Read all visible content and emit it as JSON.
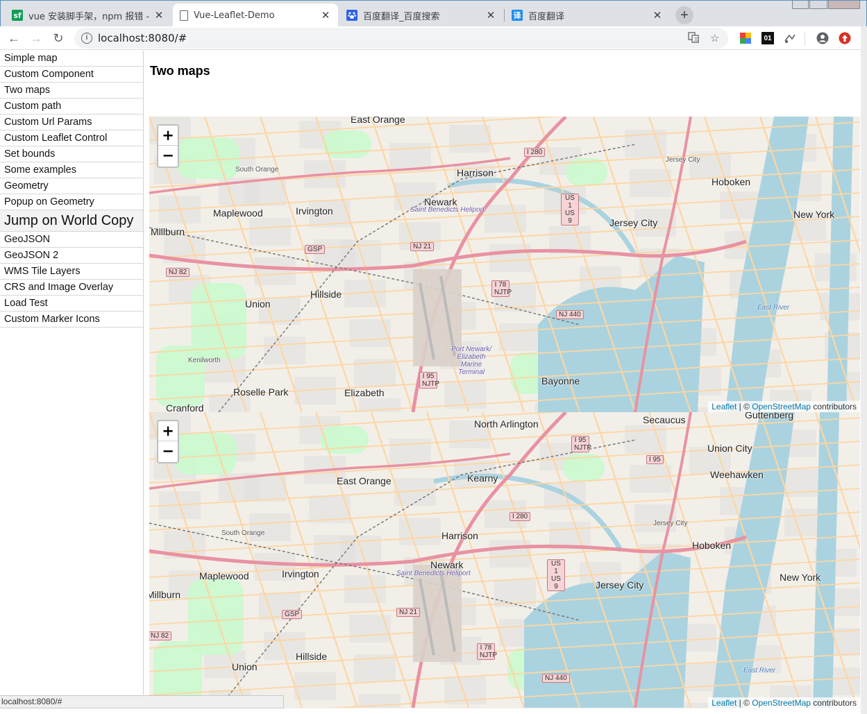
{
  "browser": {
    "tabs": [
      {
        "title": "vue 安装脚手架，npm 报错 - 青",
        "favicon": "sf",
        "favicon_color": "#0f9d58",
        "active": false
      },
      {
        "title": "Vue-Leaflet-Demo",
        "favicon": "doc",
        "favicon_color": "#5f6368",
        "active": true
      },
      {
        "title": "百度翻译_百度搜索",
        "favicon": "paw",
        "favicon_color": "#2f62e8",
        "active": false
      },
      {
        "title": "百度翻译",
        "favicon": "译",
        "favicon_color": "#1f8ef1",
        "active": false
      }
    ],
    "tab_close_glyph": "✕",
    "new_tab_glyph": "+",
    "back_glyph": "←",
    "forward_glyph": "→",
    "reload_glyph": "↻",
    "info_glyph": "i",
    "url": "localhost:8080/#",
    "extensions": [
      "01"
    ],
    "status_text": "localhost:8080/#"
  },
  "sidebar": {
    "items": [
      {
        "label": "Simple map"
      },
      {
        "label": "Custom Component"
      },
      {
        "label": "Two maps"
      },
      {
        "label": "Custom path"
      },
      {
        "label": "Custom Url Params"
      },
      {
        "label": "Custom Leaflet Control"
      },
      {
        "label": "Set bounds"
      },
      {
        "label": "Some examples"
      },
      {
        "label": "Geometry"
      },
      {
        "label": "Popup on Geometry"
      },
      {
        "label": "Jump on World Copy",
        "hover": true
      },
      {
        "label": "GeoJSON"
      },
      {
        "label": "GeoJSON 2"
      },
      {
        "label": "WMS Tile Layers"
      },
      {
        "label": "CRS and Image Overlay"
      },
      {
        "label": "Load Test"
      },
      {
        "label": "Custom Marker Icons"
      }
    ]
  },
  "main": {
    "title": "Two maps",
    "zoom_in": "+",
    "zoom_out": "−",
    "attribution": {
      "leaflet": "Leaflet",
      "sep": " | © ",
      "osm": "OpenStreetMap",
      "suffix": " contributors"
    }
  },
  "map1": {
    "places": [
      {
        "t": "East Orange",
        "cls": "big"
      },
      {
        "t": "Harrison",
        "cls": "big"
      },
      {
        "t": "Newark",
        "cls": "big"
      },
      {
        "t": "Hoboken",
        "cls": "big"
      },
      {
        "t": "New York",
        "cls": "big"
      },
      {
        "t": "Jersey City",
        "cls": "big"
      },
      {
        "t": "Irvington",
        "cls": "big"
      },
      {
        "t": "Maplewood",
        "cls": "big"
      },
      {
        "t": "South Orange",
        "cls": "small"
      },
      {
        "t": "Millburn",
        "cls": "big"
      },
      {
        "t": "Union",
        "cls": "big"
      },
      {
        "t": "Hillside",
        "cls": "big"
      },
      {
        "t": "Kenilworth",
        "cls": "small"
      },
      {
        "t": "Roselle Park",
        "cls": "big"
      },
      {
        "t": "Elizabeth",
        "cls": "big"
      },
      {
        "t": "Cranford",
        "cls": "big"
      },
      {
        "t": "Bayonne",
        "cls": "big"
      },
      {
        "t": "Saint Benedicts Heliport",
        "cls": "ital"
      },
      {
        "t": "Port Newark/ Elizabeth Marine Terminal",
        "cls": "ital"
      },
      {
        "t": "Jersey City",
        "cls": "small"
      },
      {
        "t": "East River",
        "cls": "water"
      }
    ],
    "shields": [
      "I 280",
      "US 1 US 9",
      "NJ 21",
      "GSP",
      "NJ 82",
      "I 78 NJTP",
      "NJ 440",
      "I 95 NJTP"
    ]
  },
  "map2": {
    "places": [
      {
        "t": "North Arlington",
        "cls": "big"
      },
      {
        "t": "Secaucus",
        "cls": "big"
      },
      {
        "t": "Guttenberg",
        "cls": "big"
      },
      {
        "t": "Union City",
        "cls": "big"
      },
      {
        "t": "Weehawken",
        "cls": "big"
      },
      {
        "t": "Kearny",
        "cls": "big"
      },
      {
        "t": "East Orange",
        "cls": "big"
      },
      {
        "t": "Harrison",
        "cls": "big"
      },
      {
        "t": "Newark",
        "cls": "big"
      },
      {
        "t": "Hoboken",
        "cls": "big"
      },
      {
        "t": "New York",
        "cls": "big"
      },
      {
        "t": "Jersey City",
        "cls": "big"
      },
      {
        "t": "Irvington",
        "cls": "big"
      },
      {
        "t": "Maplewood",
        "cls": "big"
      },
      {
        "t": "South Orange",
        "cls": "small"
      },
      {
        "t": "Millburn",
        "cls": "big"
      },
      {
        "t": "Union",
        "cls": "big"
      },
      {
        "t": "Hillside",
        "cls": "big"
      },
      {
        "t": "Saint Benedicts Heliport",
        "cls": "ital"
      },
      {
        "t": "Jersey City",
        "cls": "small"
      },
      {
        "t": "East River",
        "cls": "water"
      }
    ],
    "shields": [
      "I 95 NJTP",
      "I 95",
      "I 280",
      "US 1 US 9",
      "NJ 21",
      "GSP",
      "NJ 82",
      "I 78 NJTP",
      "NJ 440"
    ]
  },
  "colors": {
    "water": "#aad3df",
    "land": "#f2efe9",
    "park": "#c8facc",
    "motorway": "#e892a2",
    "primary": "#fcd6a4",
    "link": "#0078a8"
  }
}
